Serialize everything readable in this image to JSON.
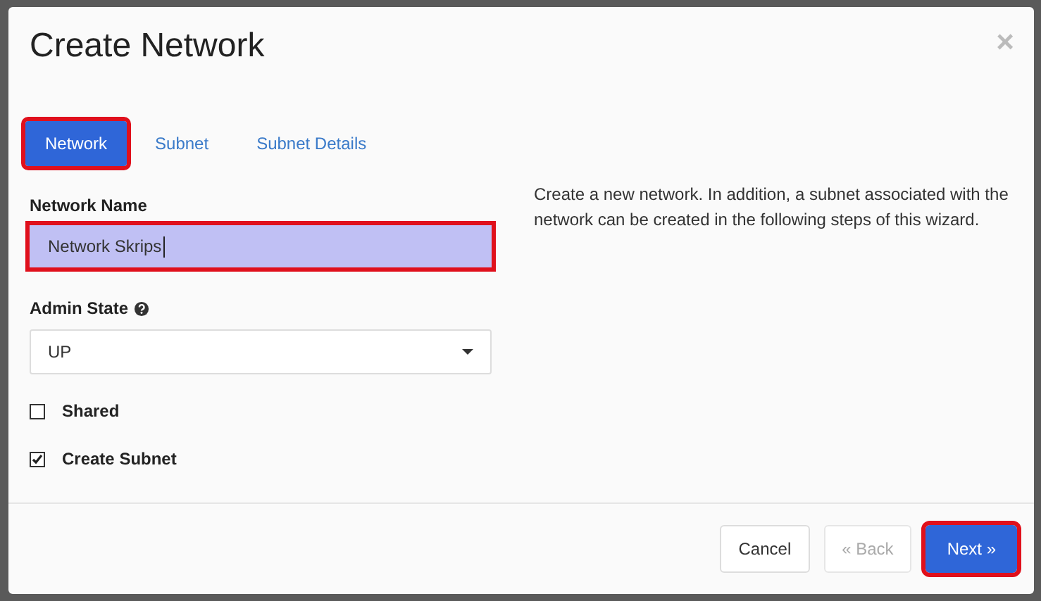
{
  "dialog": {
    "title": "Create Network",
    "close": "×"
  },
  "tabs": [
    {
      "label": "Network",
      "selected": true,
      "highlighted": true
    },
    {
      "label": "Subnet",
      "selected": false,
      "highlighted": false
    },
    {
      "label": "Subnet Details",
      "selected": false,
      "highlighted": false
    }
  ],
  "network_name": {
    "label": "Network Name",
    "value": "Network Skrips",
    "highlighted": true
  },
  "admin_state": {
    "label": "Admin State",
    "value": "UP"
  },
  "checkboxes": [
    {
      "label": "Shared",
      "checked": false
    },
    {
      "label": "Create Subnet",
      "checked": true
    }
  ],
  "description": "Create a new network. In addition, a subnet associated with the network can be created in the following steps of this wizard.",
  "buttons": [
    {
      "label": "Cancel",
      "kind": "default",
      "disabled": false,
      "highlighted": false
    },
    {
      "label": "« Back",
      "kind": "default",
      "disabled": true,
      "highlighted": false
    },
    {
      "label": "Next »",
      "kind": "primary",
      "disabled": false,
      "highlighted": true
    }
  ]
}
